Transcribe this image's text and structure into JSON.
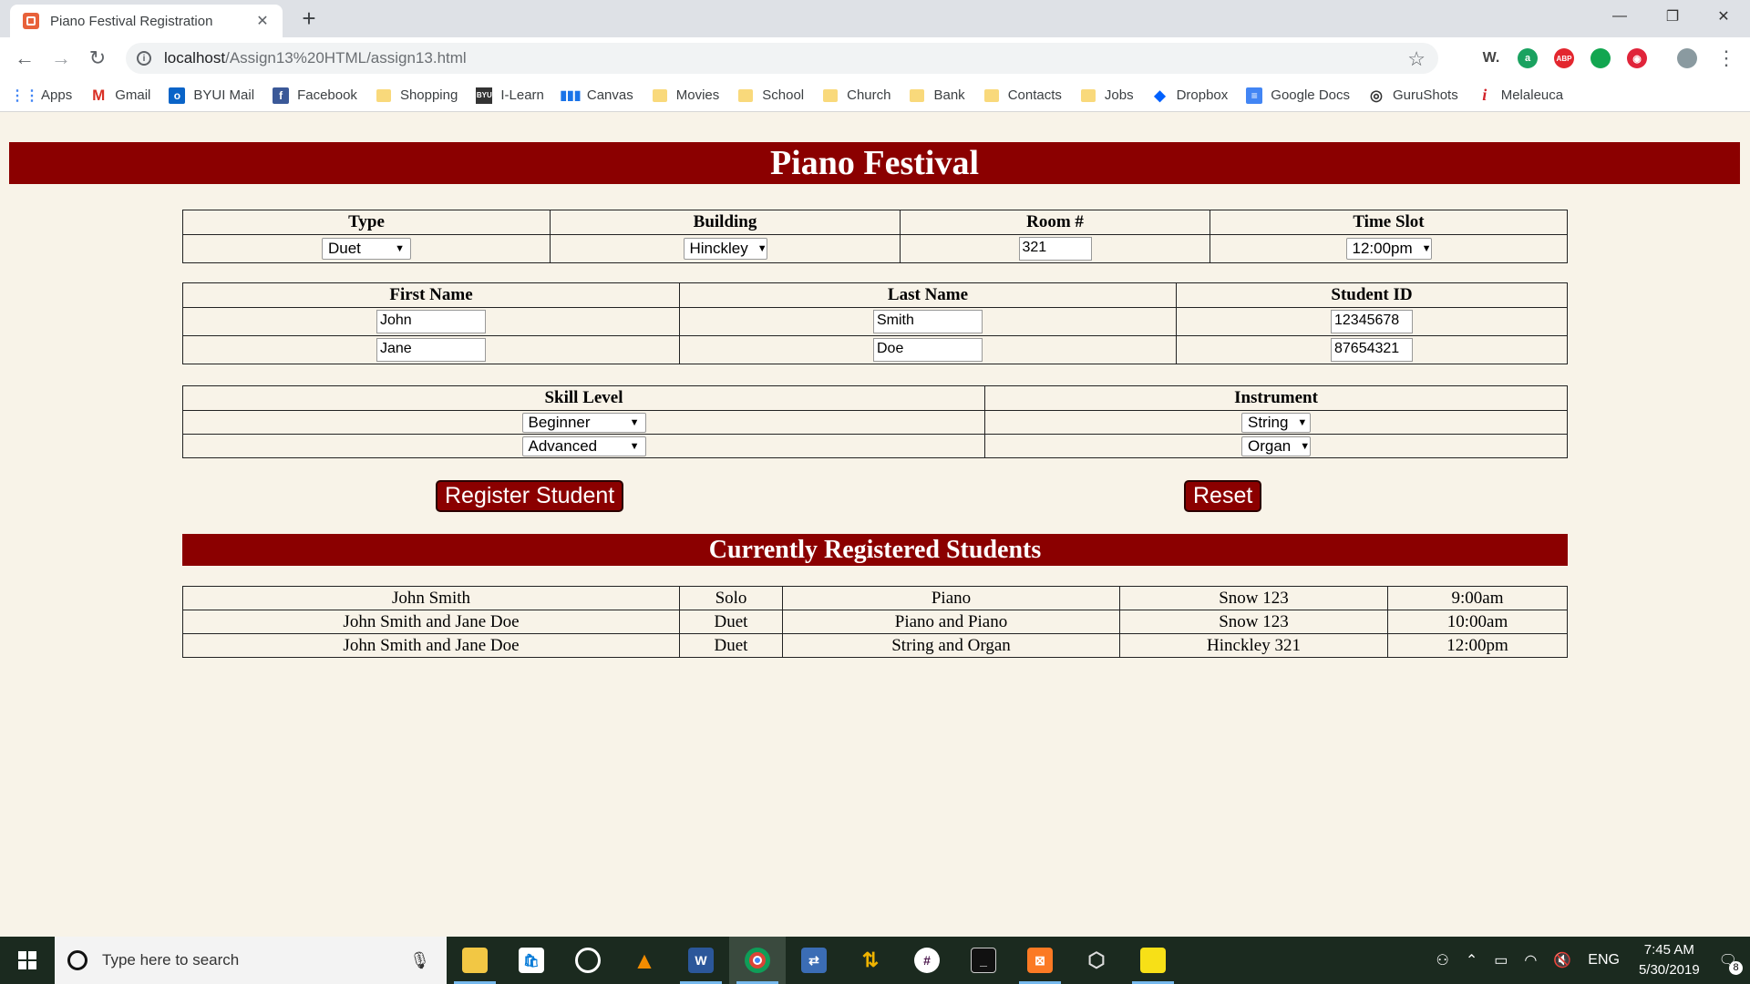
{
  "browser": {
    "tab_title": "Piano Festival Registration",
    "url_host": "localhost",
    "url_path": "/Assign13%20HTML/assign13.html",
    "bookmarks": [
      "Apps",
      "Gmail",
      "BYUI Mail",
      "Facebook",
      "Shopping",
      "I-Learn",
      "Canvas",
      "Movies",
      "School",
      "Church",
      "Bank",
      "Contacts",
      "Jobs",
      "Dropbox",
      "Google Docs",
      "GuruShots",
      "Melaleuca"
    ]
  },
  "page": {
    "title": "Piano Festival",
    "session_table": {
      "headers": [
        "Type",
        "Building",
        "Room #",
        "Time Slot"
      ],
      "type": "Duet",
      "building": "Hinckley",
      "room": "321",
      "time_slot": "12:00pm"
    },
    "students_table": {
      "headers": [
        "First Name",
        "Last Name",
        "Student ID"
      ],
      "rows": [
        {
          "first": "John",
          "last": "Smith",
          "id": "12345678"
        },
        {
          "first": "Jane",
          "last": "Doe",
          "id": "87654321"
        }
      ]
    },
    "skills_table": {
      "headers": [
        "Skill Level",
        "Instrument"
      ],
      "rows": [
        {
          "skill": "Beginner",
          "instrument": "String"
        },
        {
          "skill": "Advanced",
          "instrument": "Organ"
        }
      ]
    },
    "register_label": "Register Student",
    "reset_label": "Reset",
    "registered_title": "Currently Registered Students",
    "registered": [
      [
        "John Smith",
        "Solo",
        "Piano",
        "Snow 123",
        "9:00am"
      ],
      [
        "John Smith and Jane Doe",
        "Duet",
        "Piano and Piano",
        "Snow 123",
        "10:00am"
      ],
      [
        "John Smith and Jane Doe",
        "Duet",
        "String and Organ",
        "Hinckley 321",
        "12:00pm"
      ]
    ]
  },
  "taskbar": {
    "search_placeholder": "Type here to search",
    "language": "ENG",
    "time": "7:45 AM",
    "date": "5/30/2019",
    "notifications": "8"
  },
  "colors": {
    "accent": "#8b0000",
    "page_bg": "#f8f3e8"
  }
}
